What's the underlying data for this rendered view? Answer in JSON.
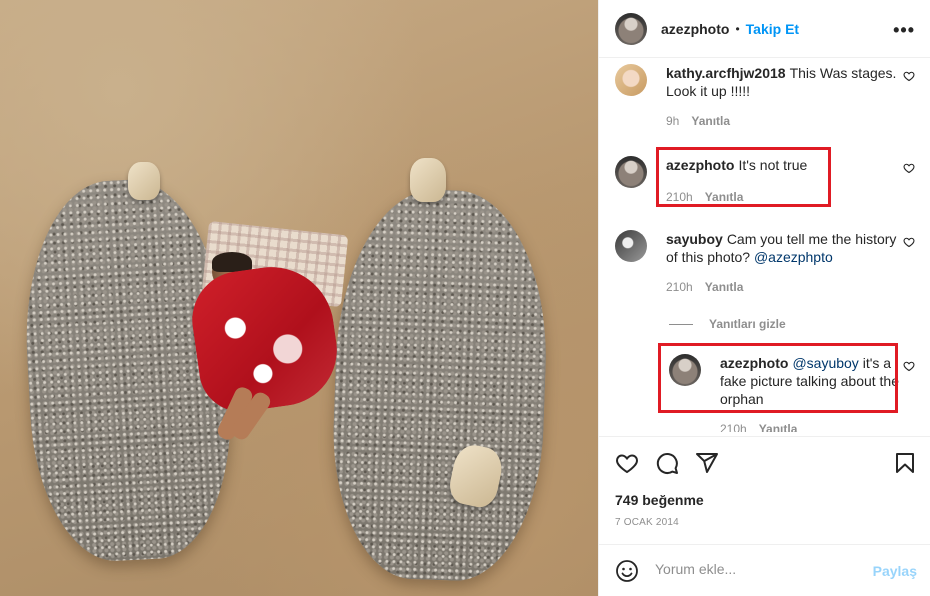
{
  "header": {
    "username": "azezphoto",
    "separator": "•",
    "follow_label": "Takip Et",
    "more_label": "•••"
  },
  "comments": [
    {
      "username": "kathy.arcfhjw2018",
      "text": "This Was stages. Look it up !!!!!",
      "time": "9h",
      "reply_label": "Yanıtla"
    },
    {
      "username": "azezphoto",
      "text": "It's not true",
      "time": "210h",
      "reply_label": "Yanıtla"
    },
    {
      "username": "sayuboy",
      "text": "Cam you tell me the history of this photo?",
      "mention": "@azezphpto",
      "time": "210h",
      "reply_label": "Yanıtla"
    }
  ],
  "hide_replies_label": "Yanıtları gizle",
  "reply": {
    "username": "azezphoto",
    "mention": "@sayuboy",
    "text": "it's a fake picture talking about the orphan",
    "time": "210h",
    "reply_label": "Yanıtla"
  },
  "actions": {
    "likes": "749 beğenme",
    "date": "7 OCAK 2014",
    "icons": [
      "heart-icon",
      "comment-icon",
      "share-icon",
      "bookmark-icon"
    ]
  },
  "composer": {
    "placeholder": "Yorum ekle...",
    "post_label": "Paylaş"
  },
  "colors": {
    "accent": "#0095f6",
    "highlight_box": "#e01b24",
    "muted": "#8e8e8e"
  }
}
